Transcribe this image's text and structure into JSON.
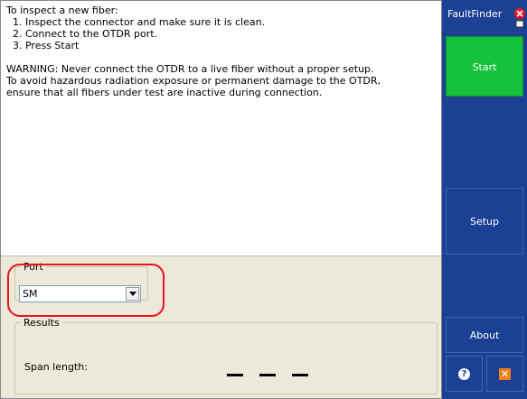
{
  "instructions": {
    "lines": [
      "To inspect a new fiber:",
      "  1. Inspect the connector and make sure it is clean.",
      "  2. Connect to the OTDR port.",
      "  3. Press Start",
      "",
      "WARNING: Never connect the OTDR to a live fiber without a proper setup.",
      "To avoid hazardous radiation exposure or permanent damage to the OTDR,",
      "ensure that all fibers under test are inactive during connection."
    ]
  },
  "port": {
    "legend": "Port",
    "value": "SM"
  },
  "results": {
    "legend": "Results",
    "span_label": "Span length:"
  },
  "sidebar": {
    "title": "FaultFinder",
    "start_label": "Start",
    "setup_label": "Setup",
    "about_label": "About",
    "help_icon": "help-icon",
    "exit_icon": "exit-icon",
    "close_icon": "close-icon"
  },
  "colors": {
    "sidebar_bg": "#1c4093",
    "start_bg": "#15c03a",
    "highlight": "#e8141d",
    "panel_bg": "#ece9d8"
  }
}
